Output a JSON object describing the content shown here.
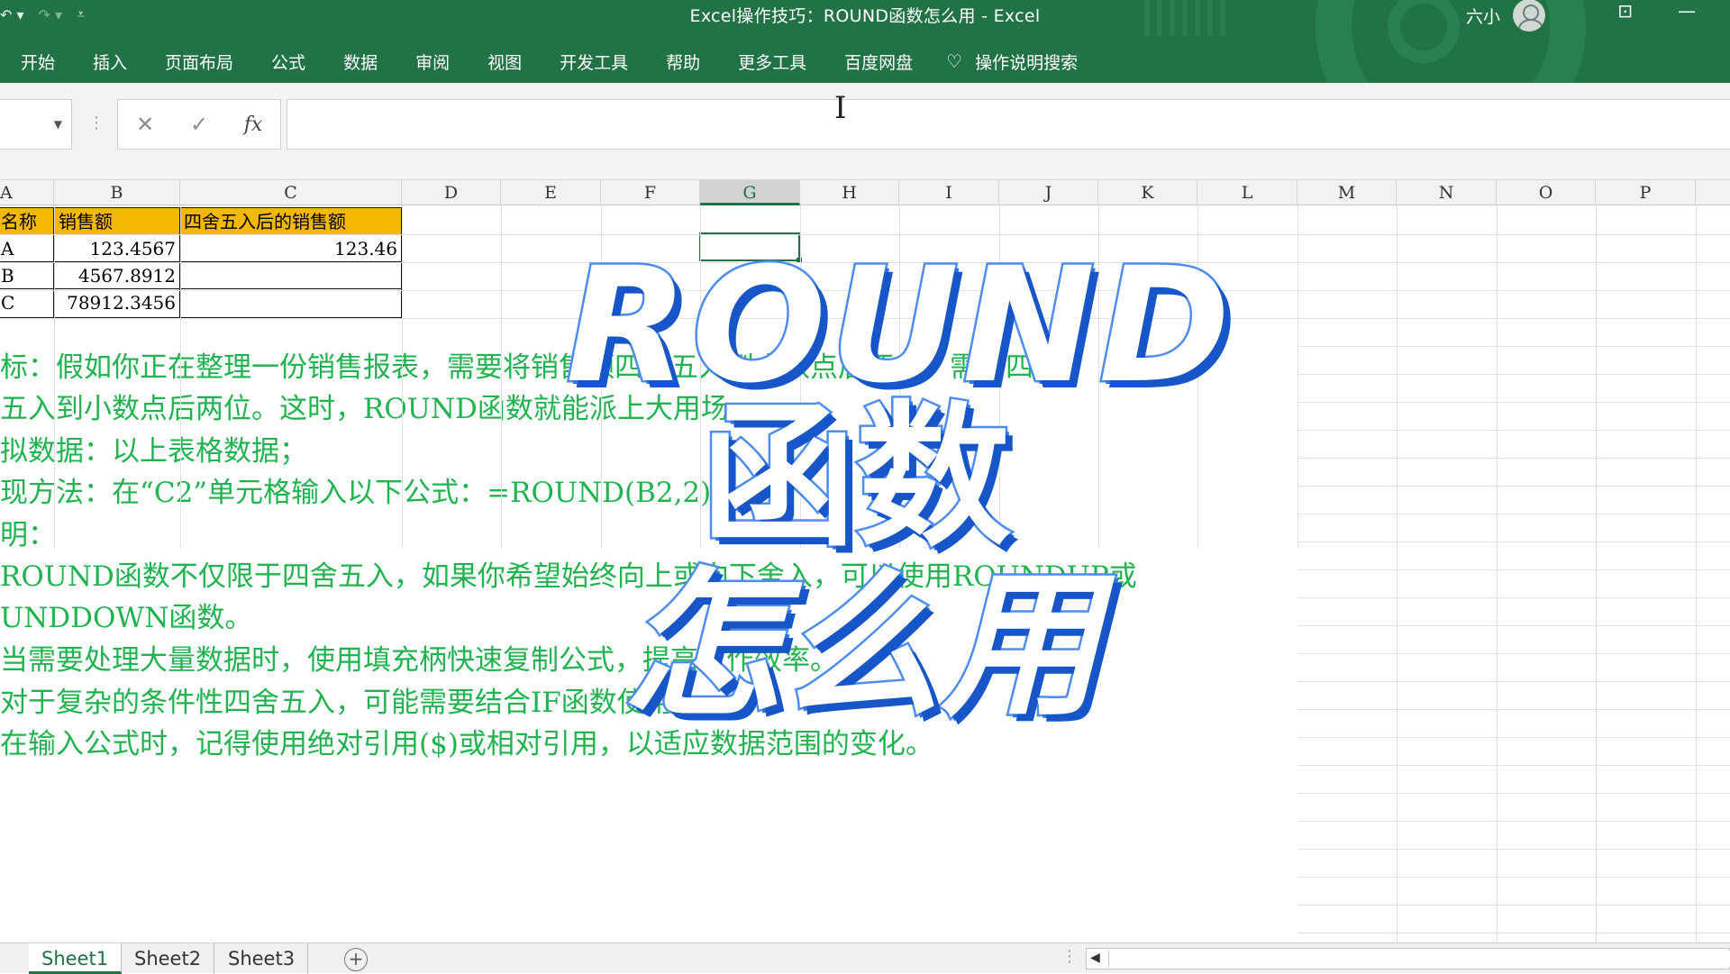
{
  "window": {
    "title": "Excel操作技巧：ROUND函数怎么用 - Excel",
    "user_name": "六小"
  },
  "qat": {
    "undo": "↶ ▾",
    "redo": "↷ ▾",
    "customize": "⩡"
  },
  "menu": [
    {
      "label": "开始"
    },
    {
      "label": "插入"
    },
    {
      "label": "页面布局"
    },
    {
      "label": "公式"
    },
    {
      "label": "数据"
    },
    {
      "label": "审阅"
    },
    {
      "label": "视图"
    },
    {
      "label": "开发工具"
    },
    {
      "label": "帮助"
    },
    {
      "label": "更多工具"
    },
    {
      "label": "百度网盘"
    }
  ],
  "search": {
    "label": "操作说明搜索"
  },
  "formula_bar": {
    "cancel": "✕",
    "enter": "✓",
    "fx": "fx",
    "value": ""
  },
  "columns": [
    "A",
    "B",
    "C",
    "D",
    "E",
    "F",
    "G",
    "H",
    "I",
    "J",
    "K",
    "L",
    "M",
    "N",
    "O",
    "P"
  ],
  "active_column": "G",
  "table": {
    "headers": [
      "名称",
      "销售额",
      "四舍五入后的销售额"
    ],
    "rows": [
      [
        "A",
        "123.4567",
        "123.46"
      ],
      [
        "B",
        "4567.8912",
        ""
      ],
      [
        "C",
        "78912.3456",
        ""
      ]
    ]
  },
  "notes": [
    "标：假如你正在整理一份销售报表，需要将销售额四舍五入到小数点后两位，需要四",
    "五入到小数点后两位。这时，ROUND函数就能派上大用场。",
    "拟数据：以上表格数据；",
    "现方法：在“C2”单元格输入以下公式：=ROUND(B2,2)",
    "明：",
    " ROUND函数不仅限于四舍五入，如果你希望始终向上或向下舍入，可以使用ROUNDUP或",
    "UNDDOWN函数。",
    " 当需要处理大量数据时，使用填充柄快速复制公式，提高工作效率。",
    " 对于复杂的条件性四舍五入，可能需要结合IF函数使用。",
    " 在输入公式时，记得使用绝对引用($)或相对引用，以适应数据范围的变化。"
  ],
  "overlay": {
    "line1": "ROUND",
    "line2": "函数",
    "line3": "怎么用"
  },
  "sheets": [
    {
      "label": "Sheet1"
    },
    {
      "label": "Sheet2"
    },
    {
      "label": "Sheet3"
    }
  ],
  "active_sheet": "Sheet1",
  "colors": {
    "excel_green": "#217346",
    "header_fill": "#f5b800",
    "note_text": "#21b34f",
    "overlay_blue": "#2f72e0"
  }
}
